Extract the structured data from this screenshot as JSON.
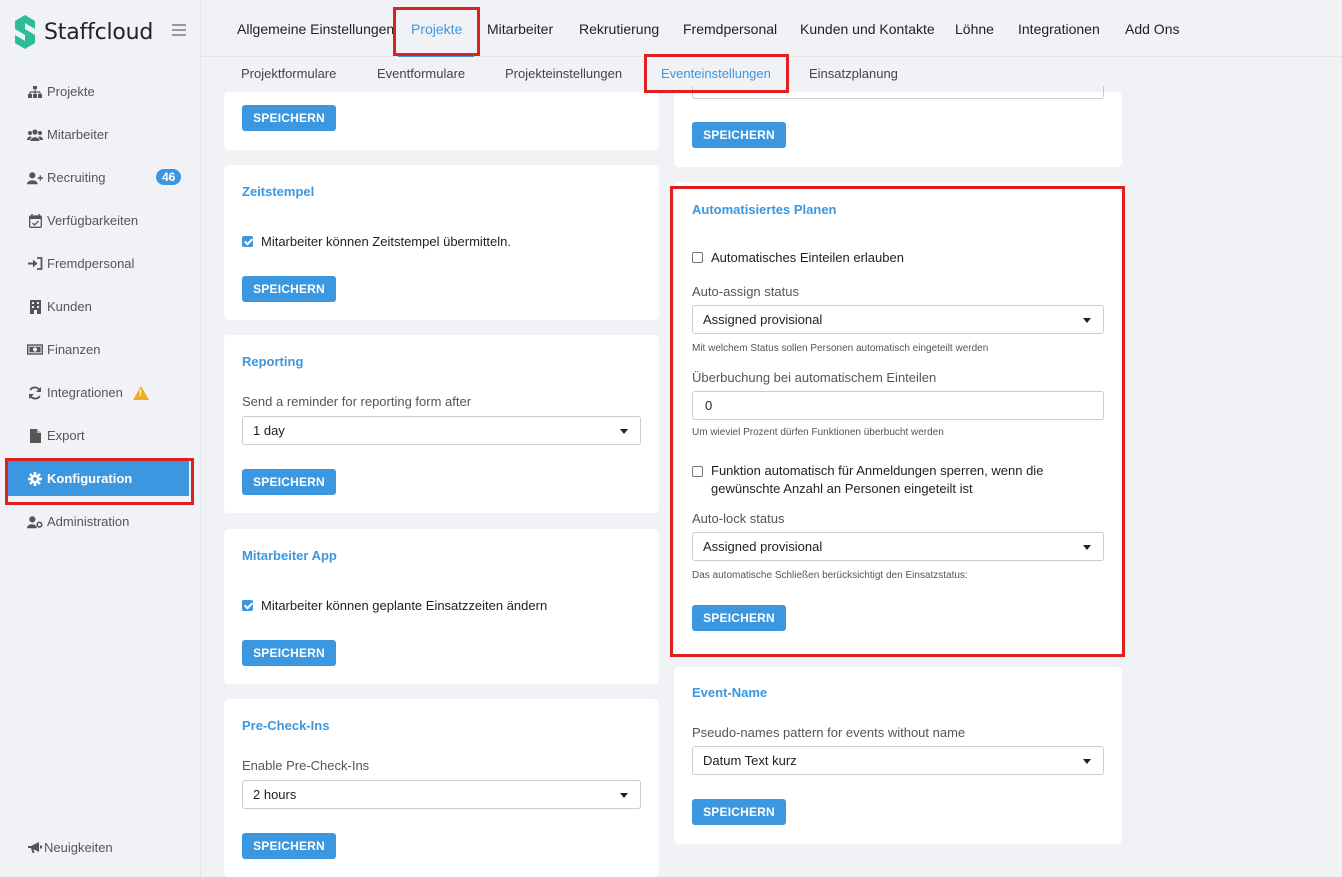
{
  "app": {
    "name": "Staffcloud",
    "brand_color": "#3a97e0",
    "logo_color": "#2bbd9a",
    "highlight_color": "#e02020"
  },
  "sidebar": {
    "items": [
      {
        "label": "Projekte",
        "icon": "sitemap-icon"
      },
      {
        "label": "Mitarbeiter",
        "icon": "users-icon"
      },
      {
        "label": "Recruiting",
        "icon": "user-plus-icon",
        "badge": "46"
      },
      {
        "label": "Verfügbarkeiten",
        "icon": "calendar-check-icon"
      },
      {
        "label": "Fremdpersonal",
        "icon": "sign-in-icon"
      },
      {
        "label": "Kunden",
        "icon": "building-icon"
      },
      {
        "label": "Finanzen",
        "icon": "money-bill-icon"
      },
      {
        "label": "Integrationen",
        "icon": "sync-icon",
        "warning": true
      },
      {
        "label": "Export",
        "icon": "file-icon"
      },
      {
        "label": "Konfiguration",
        "icon": "gear-icon",
        "active": true
      },
      {
        "label": "Administration",
        "icon": "user-cog-icon"
      }
    ],
    "news_label": "Neuigkeiten"
  },
  "top_tabs": [
    {
      "label": "Allgemeine Einstellungen"
    },
    {
      "label": "Projekte",
      "active": true
    },
    {
      "label": "Mitarbeiter"
    },
    {
      "label": "Rekrutierung"
    },
    {
      "label": "Fremdpersonal"
    },
    {
      "label": "Kunden und Kontakte"
    },
    {
      "label": "Löhne"
    },
    {
      "label": "Integrationen"
    },
    {
      "label": "Add Ons"
    }
  ],
  "sub_tabs": [
    {
      "label": "Projektformulare"
    },
    {
      "label": "Eventformulare"
    },
    {
      "label": "Projekteinstellungen"
    },
    {
      "label": "Eventeinstellungen",
      "active": true
    },
    {
      "label": "Einsatzplanung"
    }
  ],
  "save_label": "SPEICHERN",
  "left_col": {
    "zeitstempel": {
      "title": "Zeitstempel",
      "checkbox": "Mitarbeiter können Zeitstempel übermitteln.",
      "checked": true
    },
    "reporting": {
      "title": "Reporting",
      "label": "Send a reminder for reporting form after",
      "value": "1 day"
    },
    "app": {
      "title": "Mitarbeiter App",
      "checkbox": "Mitarbeiter können geplante Einsatzzeiten ändern",
      "checked": true
    },
    "precheck": {
      "title": "Pre-Check-Ins",
      "label": "Enable Pre-Check-Ins",
      "value": "2 hours"
    }
  },
  "right_col": {
    "auto": {
      "title": "Automatisiertes Planen",
      "allow_label": "Automatisches Einteilen erlauben",
      "allow_checked": false,
      "assign_status_label": "Auto-assign status",
      "assign_status_value": "Assigned provisional",
      "assign_status_help": "Mit welchem Status sollen Personen automatisch eingeteilt werden",
      "overbook_label": "Überbuchung bei automatischem Einteilen",
      "overbook_value": "0",
      "overbook_help": "Um wieviel Prozent dürfen Funktionen überbucht werden",
      "lock_label": "Funktion automatisch für Anmeldungen sperren, wenn die gewünschte Anzahl an Personen eingeteilt ist",
      "lock_checked": false,
      "lock_status_label": "Auto-lock status",
      "lock_status_value": "Assigned provisional",
      "lock_status_help": "Das automatische Schließen berücksichtigt den Einsatzstatus:"
    },
    "event_name": {
      "title": "Event-Name",
      "label": "Pseudo-names pattern for events without name",
      "value": "Datum Text kurz"
    }
  }
}
